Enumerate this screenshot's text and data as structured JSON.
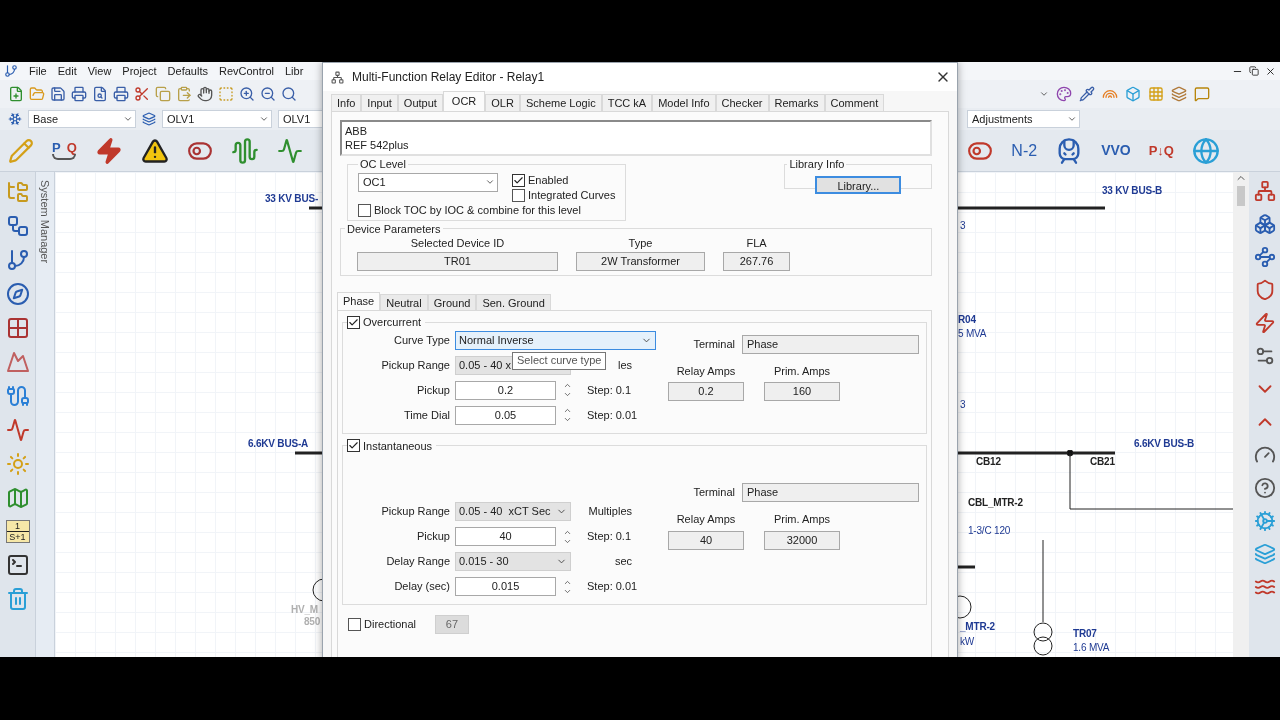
{
  "app": {
    "menu": [
      "File",
      "Edit",
      "View",
      "Project",
      "Defaults",
      "RevControl",
      "Libr"
    ],
    "combos": [
      {
        "value": "Base"
      },
      {
        "value": "OLV1"
      },
      {
        "value": "OLV1"
      },
      {
        "value": "Adjustments"
      }
    ],
    "load_flow_icon": [
      "P",
      "Q"
    ],
    "study_tools": [
      "N-2",
      "VVO",
      "P↓Q"
    ],
    "transfer_function_icon": [
      "1",
      "S+1"
    ],
    "system_manager": "System Manager",
    "canvas_labels": [
      {
        "text": "33 KV BUS-",
        "kind": "bus"
      },
      {
        "text": "6.6KV BUS-A",
        "kind": "bus"
      },
      {
        "text": "HV_M",
        "kind": "faded"
      },
      {
        "text": "850",
        "kind": "faded"
      },
      {
        "text": "33 KV BUS-B",
        "kind": "bus"
      },
      {
        "text": "3",
        "kind": "info"
      },
      {
        "text": "R04",
        "kind": "bus"
      },
      {
        "text": "5 MVA",
        "kind": "info"
      },
      {
        "text": "3",
        "kind": "info"
      },
      {
        "text": "6.6KV BUS-B",
        "kind": "bus"
      },
      {
        "text": "CB12",
        "kind": "device"
      },
      {
        "text": "CB21",
        "kind": "device"
      },
      {
        "text": "CBL_MTR-2",
        "kind": "device"
      },
      {
        "text": "1-3/C 120",
        "kind": "info"
      },
      {
        "text": "_MTR-2",
        "kind": "bus"
      },
      {
        "text": "kW",
        "kind": "info"
      },
      {
        "text": "TR07",
        "kind": "bus"
      },
      {
        "text": "1.6 MVA",
        "kind": "info"
      }
    ]
  },
  "dialog": {
    "title": "Multi-Function Relay Editor - Relay1",
    "tabs": [
      {
        "label": "Info",
        "selected": false
      },
      {
        "label": "Input",
        "selected": false
      },
      {
        "label": "Output",
        "selected": false
      },
      {
        "label": "OCR",
        "selected": true
      },
      {
        "label": "OLR",
        "selected": false
      },
      {
        "label": "Scheme Logic",
        "selected": false
      },
      {
        "label": "TCC kA",
        "selected": false
      },
      {
        "label": "Model Info",
        "selected": false
      },
      {
        "label": "Checker",
        "selected": false
      },
      {
        "label": "Remarks",
        "selected": false
      },
      {
        "label": "Comment",
        "selected": false
      }
    ],
    "description": [
      "ABB",
      "REF 542plus"
    ],
    "oc_level": {
      "title": "OC Level",
      "value": "OC1",
      "options": [
        {
          "label": "Enabled",
          "checked": true
        },
        {
          "label": "Integrated Curves",
          "checked": false
        }
      ],
      "block": {
        "label": "Block TOC by IOC & combine for this level",
        "checked": false
      }
    },
    "library": {
      "title": "Library Info",
      "button": "Library..."
    },
    "device_parameters": {
      "title": "Device Parameters",
      "fields": [
        {
          "label": "Selected Device ID",
          "value": "TR01"
        },
        {
          "label": "Type",
          "value": "2W Transformer"
        },
        {
          "label": "FLA",
          "value": "267.76"
        }
      ]
    },
    "subtabs": [
      {
        "label": "Phase",
        "selected": true
      },
      {
        "label": "Neutral",
        "selected": false
      },
      {
        "label": "Ground",
        "selected": false
      },
      {
        "label": "Sen. Ground",
        "selected": false
      }
    ],
    "sections": [
      {
        "title": "Overcurrent",
        "checked": true,
        "rows": [
          {
            "kind": "combo",
            "label": "Curve Type",
            "value": "Normal Inverse",
            "focused": true
          },
          {
            "kind": "range",
            "label": "Pickup Range",
            "value": "0.05 - 40 x",
            "unit": "les",
            "focused": false
          },
          {
            "kind": "spin",
            "label": "Pickup",
            "value": "0.2",
            "unit": "Step: 0.1",
            "focused": false
          },
          {
            "kind": "spin",
            "label": "Time Dial",
            "value": "0.05",
            "unit": "Step: 0.01",
            "focused": false
          }
        ],
        "terminal": {
          "label": "Terminal",
          "value": "Phase"
        },
        "amps": [
          {
            "label": "Relay Amps",
            "value": "0.2"
          },
          {
            "label": "Prim. Amps",
            "value": "160"
          }
        ]
      },
      {
        "title": "Instantaneous",
        "checked": true,
        "rows": [
          {
            "kind": "range",
            "label": "Pickup Range",
            "value": "0.05 - 40  xCT Sec",
            "unit": "Multiples",
            "focused": false
          },
          {
            "kind": "spin",
            "label": "Pickup",
            "value": "40",
            "unit": "Step: 0.1",
            "focused": false
          },
          {
            "kind": "range",
            "label": "Delay Range",
            "value": "0.015 - 30",
            "unit": "sec",
            "focused": false
          },
          {
            "kind": "spin",
            "label": "Delay (sec)",
            "value": "0.015",
            "unit": "Step: 0.01",
            "focused": false
          }
        ],
        "terminal": {
          "label": "Terminal",
          "value": "Phase"
        },
        "amps": [
          {
            "label": "Relay Amps",
            "value": "40"
          },
          {
            "label": "Prim. Amps",
            "value": "32000"
          }
        ]
      }
    ],
    "directional": {
      "label": "Directional",
      "checked": false,
      "value": "67"
    },
    "tooltip": "Select curve type"
  }
}
